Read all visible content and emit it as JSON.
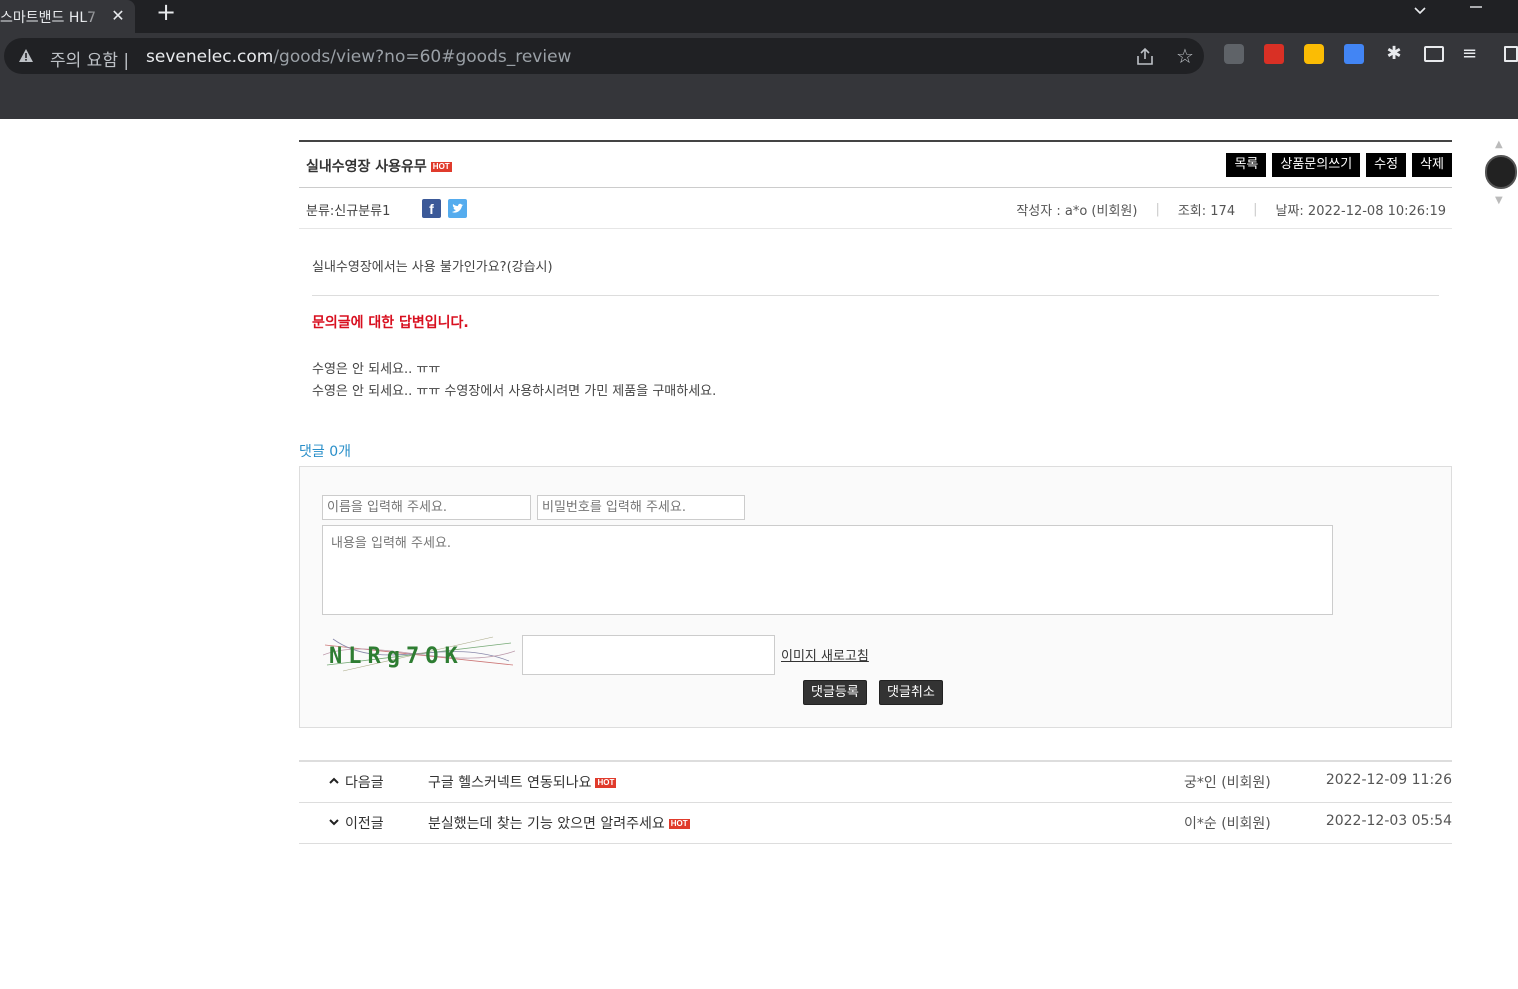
{
  "browser": {
    "tab_title": "스마트밴드 HL7",
    "tab_close": "✕",
    "new_tab": "+",
    "security_label": "주의 요함",
    "url_host": "sevenelec.com",
    "url_path": "/goods/view?no=60#goods_review"
  },
  "post": {
    "title": "실내수영장 사용유무",
    "hot_badge": "HOT",
    "buttons": [
      "목록",
      "상품문의쓰기",
      "수정",
      "삭제"
    ],
    "category": "분류:신규분류1",
    "author": "작성자 : a*o (비회원)",
    "views": "조회: 174",
    "date": "날짜: 2022-12-08 10:26:19",
    "question": "실내수영장에서는 사용 불가인가요?(강습시)",
    "answer_heading": "문의글에 대한 답변입니다.",
    "answer_lines": [
      "수영은 안 되세요.. ㅠㅠ",
      "수영은 안 되세요.. ㅠㅠ 수영장에서 사용하시려면 가민 제품을 구매하세요."
    ]
  },
  "comments": {
    "count_label": "댓글 0개",
    "name_placeholder": "이름을 입력해 주세요.",
    "password_placeholder": "비밀번호를 입력해 주세요.",
    "content_placeholder": "내용을 입력해 주세요.",
    "captcha_text": "NLRg7OK",
    "refresh_label": "이미지 새로고침",
    "submit_label": "댓글등록",
    "cancel_label": "댓글취소"
  },
  "navigation": [
    {
      "label": "다음글",
      "arrow": "▲",
      "title": "구글 헬스커넥트 연동되나요",
      "hot": "HOT",
      "author": "궁*인 (비회원)",
      "date": "2022-12-09 11:26"
    },
    {
      "label": "이전글",
      "arrow": "▼",
      "title": "분실했는데 찾는 기능 았으면 알려주세요",
      "hot": "HOT",
      "author": "이*순 (비회원)",
      "date": "2022-12-03 05:54"
    }
  ],
  "colors": {
    "accent_red": "#d80f1f",
    "link_blue": "#2a8fc9",
    "hot_red": "#e03b2c"
  }
}
